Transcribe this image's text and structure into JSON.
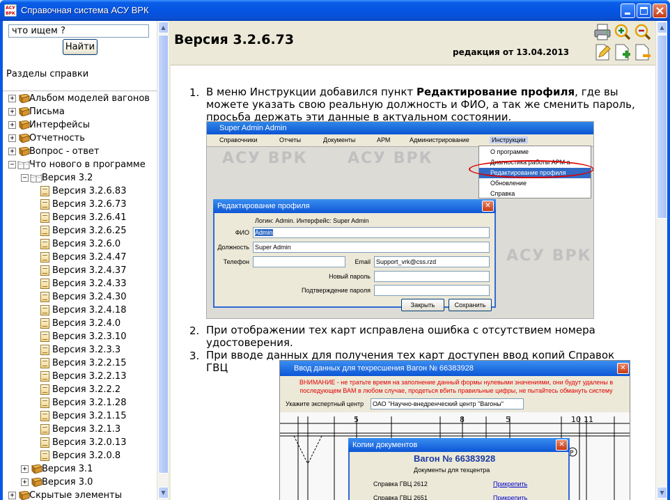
{
  "window": {
    "title": "Справочная система АСУ ВРК",
    "icon_text": "АСУ ВРК"
  },
  "search": {
    "value": "что ищем ?",
    "button": "Найти"
  },
  "sections_label": "Разделы справки",
  "tree": [
    {
      "label": "Альбом моделей вагонов",
      "expander": "+",
      "icon": "book-icon"
    },
    {
      "label": "Письма",
      "expander": "+",
      "icon": "book-icon"
    },
    {
      "label": "Интерфейсы",
      "expander": "+",
      "icon": "book-icon"
    },
    {
      "label": "Отчетность",
      "expander": "+",
      "icon": "book-icon"
    },
    {
      "label": "Вопрос - ответ",
      "expander": "+",
      "icon": "book-icon"
    },
    {
      "label": "Что нового в программе",
      "expander": "−",
      "icon": "open-book-icon"
    },
    {
      "label": "Версия 3.2",
      "expander": "−",
      "icon": "open-book-icon"
    },
    {
      "label": "Версия 3.2.6.83",
      "icon": "page-icon"
    },
    {
      "label": "Версия 3.2.6.73",
      "icon": "page-icon"
    },
    {
      "label": "Версия 3.2.6.41",
      "icon": "page-icon"
    },
    {
      "label": "Версия 3.2.6.25",
      "icon": "page-icon"
    },
    {
      "label": "Версия 3.2.6.0",
      "icon": "page-icon"
    },
    {
      "label": "Версия 3.2.4.47",
      "icon": "page-icon"
    },
    {
      "label": "Версия 3.2.4.37",
      "icon": "page-icon"
    },
    {
      "label": "Версия 3.2.4.33",
      "icon": "page-icon"
    },
    {
      "label": "Версия 3.2.4.30",
      "icon": "page-icon"
    },
    {
      "label": "Версия 3.2.4.18",
      "icon": "page-icon"
    },
    {
      "label": "Версия 3.2.4.0",
      "icon": "page-icon"
    },
    {
      "label": "Версия 3.2.3.10",
      "icon": "page-icon"
    },
    {
      "label": "Версия 3.2.3.3",
      "icon": "page-icon"
    },
    {
      "label": "Версия 3.2.2.15",
      "icon": "page-icon"
    },
    {
      "label": "Версия 3.2.2.13",
      "icon": "page-icon"
    },
    {
      "label": "Версия 3.2.2.2",
      "icon": "page-icon"
    },
    {
      "label": "Версия 3.2.1.28",
      "icon": "page-icon"
    },
    {
      "label": "Версия 3.2.1.15",
      "icon": "page-icon"
    },
    {
      "label": "Версия 3.2.1.3",
      "icon": "page-icon"
    },
    {
      "label": "Версия 3.2.0.13",
      "icon": "page-icon"
    },
    {
      "label": "Версия 3.2.0.8",
      "icon": "page-icon"
    },
    {
      "label": "Версия 3.1",
      "expander": "+",
      "icon": "book-icon"
    },
    {
      "label": "Версия 3.0",
      "expander": "+",
      "icon": "book-icon"
    },
    {
      "label": "Скрытые элементы",
      "expander": "+",
      "icon": "book-icon"
    }
  ],
  "page": {
    "title": "Версия 3.2.6.73",
    "edition": "редакция от 13.04.2013",
    "toolbar": [
      "print-icon",
      "zoom-in-icon",
      "zoom-out-icon",
      "edit-icon",
      "add-icon",
      "remove-icon"
    ],
    "items": [
      {
        "num": "1.",
        "before": "В меню Инструкции добавился пункт ",
        "bold": "Редактирование профиля",
        "after": ", где вы можете указать свою реальную должность и ФИО, а так же сменить пароль, просьба держать эти данные в актуальном состоянии."
      },
      {
        "num": "2.",
        "text": "При отображении тех карт исправлена ошибка с отсутствием номера удостоверения."
      },
      {
        "num": "3.",
        "text": "При вводе данных для получения тех карт доступен ввод копий Справок ГВЦ"
      }
    ]
  },
  "shot1": {
    "title": "Super Admin Admin",
    "menu": [
      "Справочники",
      "Отчеты",
      "Документы",
      "АРМ",
      "Администрирование",
      "Инструкции"
    ],
    "dropdown": [
      "О программе",
      "Диагностика работы АРМ а",
      "Редактирование профиля",
      "Обновление",
      "Справка"
    ],
    "watermark": "АСУ ВРК",
    "dialog": {
      "title": "Редактирование профиля",
      "info": "Логин: Admin. Интерфейс: Super Admin",
      "fio_label": "ФИО",
      "fio": "Admin",
      "post_label": "Должность",
      "post": "Super Admin",
      "phone_label": "Телефон",
      "phone": "",
      "email_label": "Email",
      "email": "Support_vrk@css.rzd",
      "newpass_label": "Новый пароль",
      "confirm_label": "Подтверждение пароля",
      "close_btn": "Закрыть",
      "save_btn": "Сохранить"
    }
  },
  "shot2": {
    "title": "Ввод данных для техресшения Вагон № 66383928",
    "warning_1": "ВНИМАНИЕ - не тратьте время на заполнение данный формы нулевыми значениями, они будут удалены в",
    "warning_2": "последующем ВАМ в любом случае, продеться вбить правильные цифры, не пытайтесь обмануть систему",
    "expert_label": "Укажите экспертный центр",
    "expert_value": "ОАО \"Научно-внедренческий центр \"Вагоны\"",
    "dialog_title": "Копии документов",
    "wagon": "Вагон № 66383928",
    "docs_label": "Документы для техцентра",
    "rows": [
      {
        "label": "Справка ГВЦ 2612",
        "link": "Прикрепить"
      },
      {
        "label": "Справка ГВЦ 2651",
        "link": "Прикрепить"
      }
    ],
    "drawing_numbers": [
      "5",
      "8",
      "5",
      "10",
      "11"
    ],
    "drawing_letter": "P"
  }
}
